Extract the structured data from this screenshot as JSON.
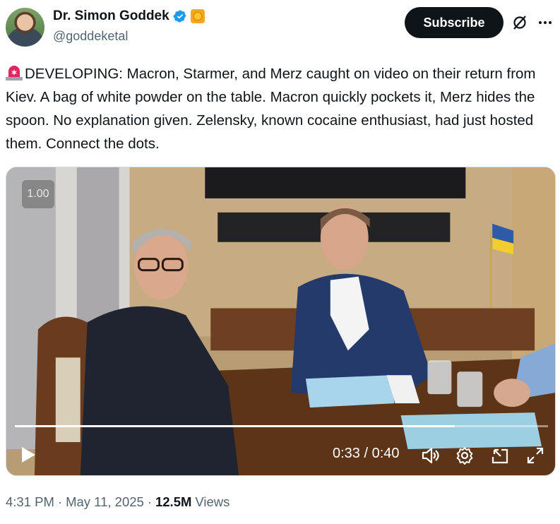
{
  "author": {
    "display_name": "Dr. Simon Goddek",
    "handle": "@goddeketal",
    "avatar_icon": "profile-photo",
    "verified_icon": "verified-badge-icon",
    "affiliate_icon": "gold-badge-icon"
  },
  "actions": {
    "subscribe_label": "Subscribe",
    "grok_icon": "grok-icon",
    "more_icon": "more-dots-icon"
  },
  "tweet": {
    "emoji_icon": "rotating-light-icon",
    "text": "DEVELOPING: Macron, Starmer, and Merz caught on video on their return from Kiev. A bag of white powder on the table. Macron quickly pockets it, Merz hides the spoon. No explanation given. Zelensky, known cocaine enthusiast, had just hosted them. Connect the dots."
  },
  "video": {
    "playback_speed": "1.00",
    "time_display": "0:33 / 0:40",
    "progress_fraction": 0.825,
    "controls": [
      "play-icon",
      "volume-icon",
      "settings-icon",
      "pip-icon",
      "fullscreen-icon"
    ]
  },
  "meta": {
    "time": "4:31 PM",
    "separator": "·",
    "date": "May 11, 2025",
    "views_count": "12.5M",
    "views_label": "Views"
  },
  "colors": {
    "primary_text": "#0f1419",
    "secondary_text": "#536471",
    "verified_blue": "#1d9bf0",
    "subscribe_bg": "#0f1419"
  }
}
